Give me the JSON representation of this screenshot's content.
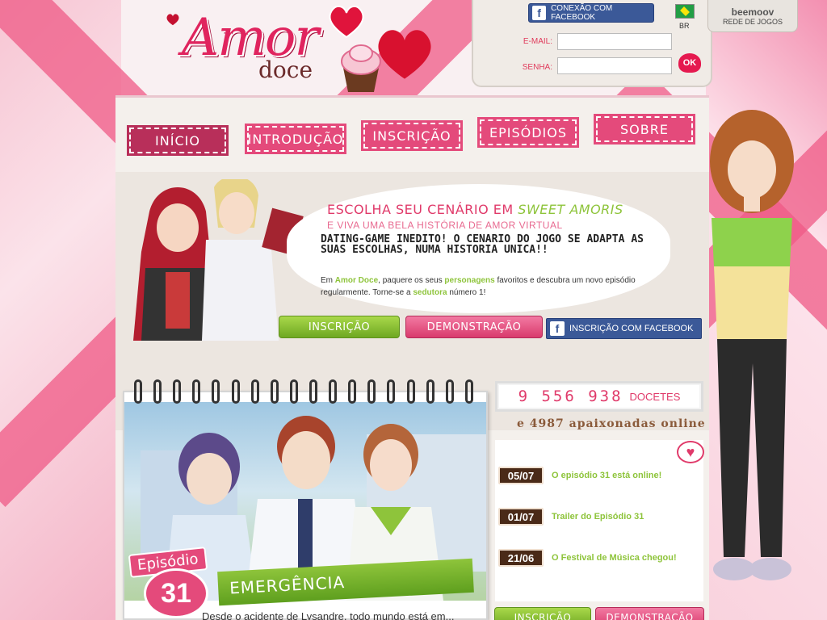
{
  "logo": {
    "amor": "Amor",
    "doce": "doce"
  },
  "login": {
    "facebook_connect": "CONEXÃO COM FACEBOOK",
    "lang": "BR",
    "email_label": "E-MAIL:",
    "password_label": "SENHA:",
    "ok_label": "OK"
  },
  "network": {
    "brand": "beemoov",
    "label": "REDE DE JOGOS"
  },
  "nav": {
    "items": [
      {
        "label": "Início"
      },
      {
        "label": "Introdução"
      },
      {
        "label": "Inscrição"
      },
      {
        "label": "Episódios"
      },
      {
        "label": "Sobre"
      }
    ]
  },
  "hero": {
    "title_prefix": "ESCOLHA SEU CENÁRIO EM ",
    "title_highlight": "SWEET AMORIS",
    "subtitle": "E VIVA UMA BELA HISTÓRIA DE AMOR VIRTUAL",
    "bold_text": "DATING-GAME INEDITO! O CENARIO DO JOGO SE ADAPTA AS SUAS ESCOLHAS, NUMA HISTORIA UNICA!!",
    "desc_1": "Em ",
    "desc_brand": "Amor Doce",
    "desc_2": ", paquere os seus ",
    "desc_chars": "personagens",
    "desc_3": " favoritos e descubra um novo episódio regularmente. Torne-se a ",
    "desc_role": "sedutora",
    "desc_4": " número 1!",
    "signup_button": "Inscrição",
    "demo_button": "Demonstração",
    "facebook_button": "INSCRIÇÃO COM FACEBOOK"
  },
  "episode": {
    "badge_label": "Episódio",
    "number": "31",
    "title": "EMERGÊNCIA",
    "desc": "Desde o acidente de Lysandre, todo mundo está em..."
  },
  "stats": {
    "count": "9 556 938",
    "count_label": "DOCETES",
    "online": "e 4987 apaixonadas online"
  },
  "news": [
    {
      "date": "05/07",
      "text": "O episódio 31 está online!"
    },
    {
      "date": "01/07",
      "text": "Trailer do Episódio 31"
    },
    {
      "date": "21/06",
      "text": "O Festival de Música chegou!"
    }
  ],
  "footer_buttons": {
    "signup": "Inscrição",
    "demo": "Demonstração"
  },
  "colors": {
    "pink": "#e44a7b",
    "green": "#8ec43b",
    "facebook": "#3b5998"
  }
}
